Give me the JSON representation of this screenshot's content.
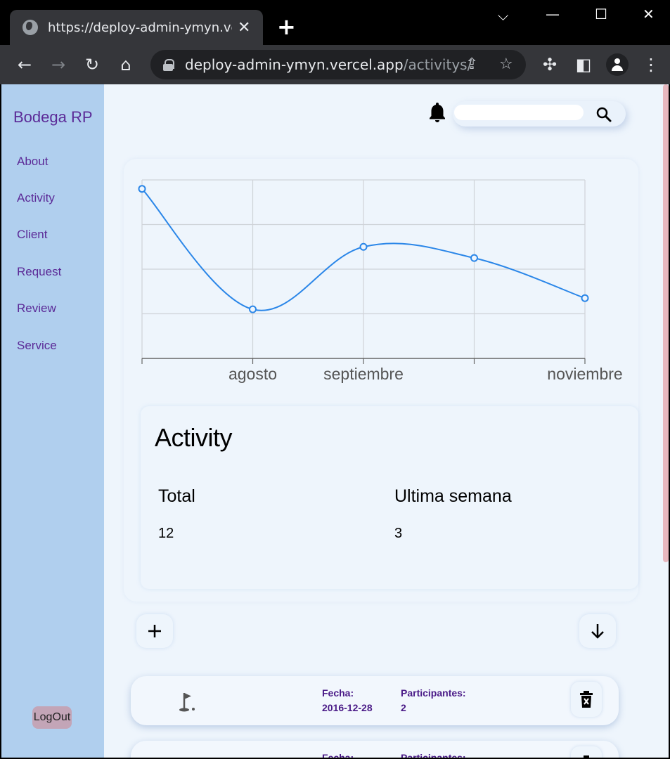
{
  "browser": {
    "tab_title": "https://deploy-admin-ymyn.vercel.app/activitys/",
    "url_host": "deploy-admin-ymyn.vercel.app",
    "url_path": "/activitys/"
  },
  "sidebar": {
    "brand": "Bodega RP",
    "items": [
      {
        "label": "About"
      },
      {
        "label": "Activity"
      },
      {
        "label": "Client"
      },
      {
        "label": "Request"
      },
      {
        "label": "Review"
      },
      {
        "label": "Service"
      }
    ],
    "logout_label": "LogOut"
  },
  "header": {
    "search_placeholder": ""
  },
  "chart_data": {
    "type": "line",
    "x": [
      "",
      "agosto",
      "septiembre",
      "",
      "noviembre"
    ],
    "tick_labels": [
      "agosto",
      "septiembre",
      "noviembre"
    ],
    "values": [
      3.8,
      1.1,
      2.5,
      2.25,
      1.35
    ],
    "ylim": [
      0,
      4
    ],
    "grid": true,
    "line_color": "#2a86e8"
  },
  "activity": {
    "title": "Activity",
    "total_label": "Total",
    "total_value": "12",
    "week_label": "Ultima semana",
    "week_value": "3"
  },
  "rows": [
    {
      "fecha_label": "Fecha:",
      "fecha": "2016-12-28",
      "part_label": "Participantes:",
      "part": "2"
    },
    {
      "fecha_label": "Fecha:",
      "fecha": "",
      "part_label": "Participantes:",
      "part": ""
    }
  ],
  "colors": {
    "sidebar": "#b0cfee",
    "accent_purple": "#5b2a97",
    "page_bg": "#eef5fc"
  }
}
